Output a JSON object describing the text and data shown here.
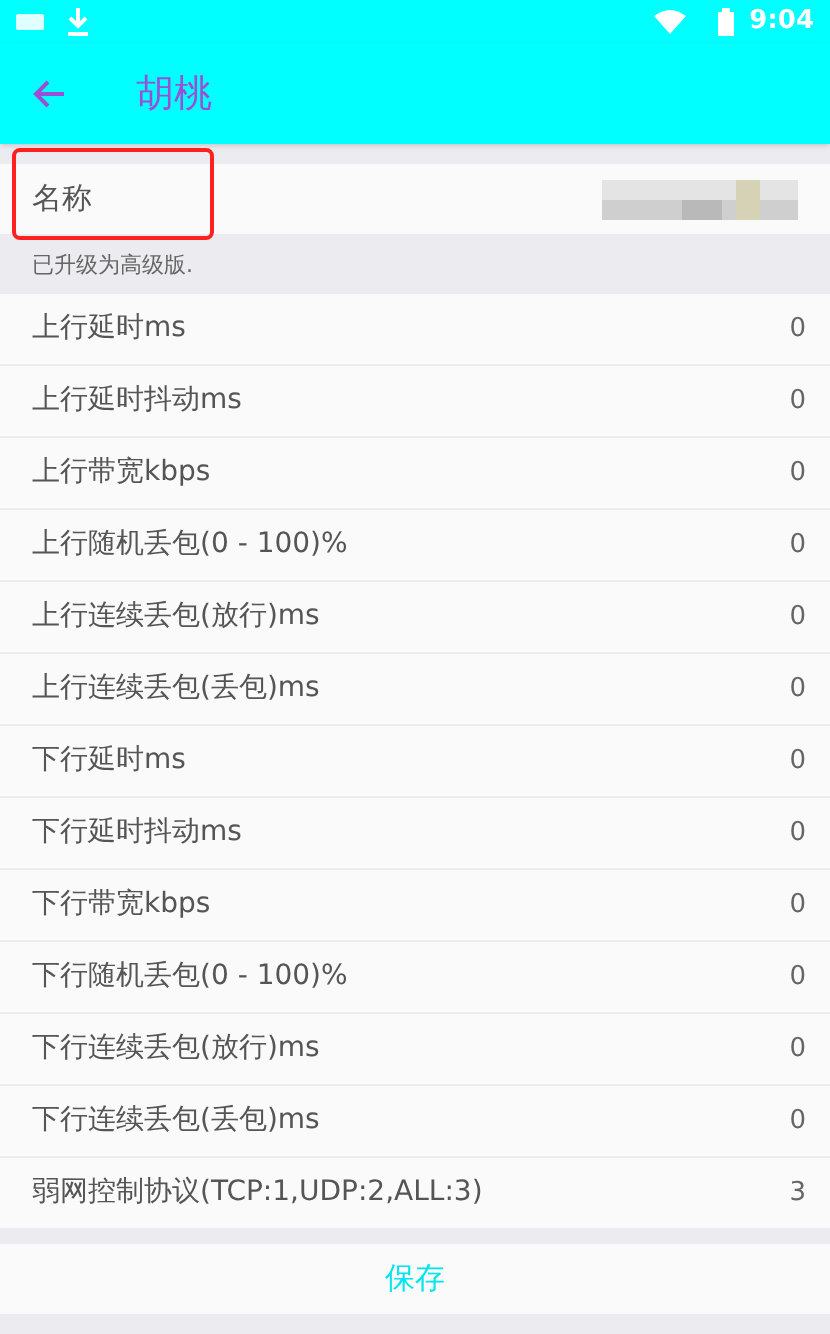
{
  "status_bar": {
    "time": "9:04"
  },
  "app_bar": {
    "title": "胡桃"
  },
  "name_field": {
    "label": "名称",
    "highlighted": true
  },
  "hint": "已升级为高级版.",
  "settings": [
    {
      "label": "上行延时ms",
      "value": "0"
    },
    {
      "label": "上行延时抖动ms",
      "value": "0"
    },
    {
      "label": "上行带宽kbps",
      "value": "0"
    },
    {
      "label": "上行随机丢包(0 - 100)%",
      "value": "0"
    },
    {
      "label": "上行连续丢包(放行)ms",
      "value": "0"
    },
    {
      "label": "上行连续丢包(丢包)ms",
      "value": "0"
    },
    {
      "label": "下行延时ms",
      "value": "0"
    },
    {
      "label": "下行延时抖动ms",
      "value": "0"
    },
    {
      "label": "下行带宽kbps",
      "value": "0"
    },
    {
      "label": "下行随机丢包(0 - 100)%",
      "value": "0"
    },
    {
      "label": "下行连续丢包(放行)ms",
      "value": "0"
    },
    {
      "label": "下行连续丢包(丢包)ms",
      "value": "0"
    },
    {
      "label": "弱网控制协议(TCP:1,UDP:2,ALL:3)",
      "value": "3"
    }
  ],
  "save_button": "保存"
}
